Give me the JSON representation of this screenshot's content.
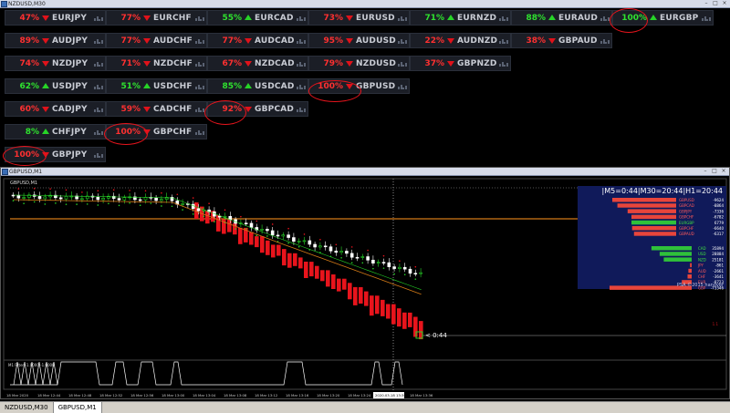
{
  "top_window": {
    "title": "NZDUSD,M30"
  },
  "grid": {
    "rows": [
      [
        {
          "pct": "47%",
          "dir": "down",
          "color": "red",
          "sym": "EURJPY"
        },
        {
          "pct": "77%",
          "dir": "down",
          "color": "red",
          "sym": "EURCHF"
        },
        {
          "pct": "55%",
          "dir": "up",
          "color": "green",
          "sym": "EURCAD"
        },
        {
          "pct": "73%",
          "dir": "down",
          "color": "red",
          "sym": "EURUSD"
        },
        {
          "pct": "71%",
          "dir": "up",
          "color": "green",
          "sym": "EURNZD"
        },
        {
          "pct": "88%",
          "dir": "up",
          "color": "green",
          "sym": "EURAUD"
        },
        {
          "pct": "100%",
          "dir": "up",
          "color": "green",
          "sym": "EURGBP"
        }
      ],
      [
        {
          "pct": "89%",
          "dir": "down",
          "color": "red",
          "sym": "AUDJPY"
        },
        {
          "pct": "77%",
          "dir": "down",
          "color": "red",
          "sym": "AUDCHF"
        },
        {
          "pct": "77%",
          "dir": "down",
          "color": "red",
          "sym": "AUDCAD"
        },
        {
          "pct": "95%",
          "dir": "down",
          "color": "red",
          "sym": "AUDUSD"
        },
        {
          "pct": "22%",
          "dir": "down",
          "color": "red",
          "sym": "AUDNZD"
        },
        {
          "pct": "38%",
          "dir": "down",
          "color": "red",
          "sym": "GBPAUD"
        }
      ],
      [
        {
          "pct": "74%",
          "dir": "down",
          "color": "red",
          "sym": "NZDJPY"
        },
        {
          "pct": "71%",
          "dir": "down",
          "color": "red",
          "sym": "NZDCHF"
        },
        {
          "pct": "67%",
          "dir": "down",
          "color": "red",
          "sym": "NZDCAD"
        },
        {
          "pct": "79%",
          "dir": "down",
          "color": "red",
          "sym": "NZDUSD"
        },
        {
          "pct": "37%",
          "dir": "down",
          "color": "red",
          "sym": "GBPNZD"
        }
      ],
      [
        {
          "pct": "62%",
          "dir": "up",
          "color": "green",
          "sym": "USDJPY"
        },
        {
          "pct": "51%",
          "dir": "up",
          "color": "green",
          "sym": "USDCHF"
        },
        {
          "pct": "85%",
          "dir": "up",
          "color": "green",
          "sym": "USDCAD"
        },
        {
          "pct": "100%",
          "dir": "down",
          "color": "red",
          "sym": "GBPUSD"
        }
      ],
      [
        {
          "pct": "60%",
          "dir": "down",
          "color": "red",
          "sym": "CADJPY"
        },
        {
          "pct": "59%",
          "dir": "down",
          "color": "red",
          "sym": "CADCHF"
        },
        {
          "pct": "92%",
          "dir": "down",
          "color": "red",
          "sym": "GBPCAD"
        }
      ],
      [
        {
          "pct": "8%",
          "dir": "up",
          "color": "green",
          "sym": "CHFJPY"
        },
        {
          "pct": "100%",
          "dir": "down",
          "color": "red",
          "sym": "GBPCHF"
        }
      ],
      [
        {
          "pct": "100%",
          "dir": "down",
          "color": "red",
          "sym": "GBPJPY"
        }
      ]
    ]
  },
  "chart_window": {
    "title": "GBPUSD,M1",
    "inner_label": "GBPUSD,M1"
  },
  "chart": {
    "price_label": "< 0:44",
    "indicator_label": "M1 Filter -1.0000 -1.0000",
    "date_tooltip": "2020.03.18 13:36",
    "time_ticks": [
      "18 Mar 2020",
      "18 Mar 12:44",
      "18 Mar 12:48",
      "18 Mar 12:52",
      "18 Mar 12:56",
      "18 Mar 13:00",
      "18 Mar 13:04",
      "18 Mar 13:08",
      "18 Mar 13:12",
      "18 Mar 13:16",
      "18 Mar 13:20",
      "18 Mar 13:24",
      "18 Mar 13:28",
      "18 Mar 13:36"
    ]
  },
  "psa_panel": {
    "header": "|M5=0:44|M30=20:44|H1=20:44",
    "pairs": [
      {
        "name": "GBPUSD",
        "value": "-9624",
        "color": "red",
        "strength": 1.0
      },
      {
        "name": "GBPCAD",
        "value": "-8864",
        "color": "red",
        "strength": 0.92
      },
      {
        "name": "GBPJPY",
        "value": "-7336",
        "color": "red",
        "strength": 0.76
      },
      {
        "name": "GBPCHF",
        "value": "-6782",
        "color": "red",
        "strength": 0.7
      },
      {
        "name": "EURGBP",
        "value": "6779",
        "color": "green",
        "strength": 0.7
      },
      {
        "name": "GBPCHF",
        "value": "-6640",
        "color": "red",
        "strength": 0.69
      },
      {
        "name": "GBPAUD",
        "value": "-6317",
        "color": "red",
        "strength": 0.66
      }
    ],
    "currencies": [
      {
        "name": "CAD",
        "value": "35894",
        "color": "green",
        "strength": 0.49
      },
      {
        "name": "USD",
        "value": "28884",
        "color": "green",
        "strength": 0.39
      },
      {
        "name": "NZD",
        "value": "25181",
        "color": "green",
        "strength": 0.34
      },
      {
        "name": "JPY",
        "value": "-861",
        "color": "red",
        "strength": 0.02
      },
      {
        "name": "AUD",
        "value": "-2661",
        "color": "red",
        "strength": 0.04
      },
      {
        "name": "CHF",
        "value": "-3641",
        "color": "red",
        "strength": 0.05
      },
      {
        "name": "EUR",
        "value": "-8723",
        "color": "red",
        "strength": 0.12
      },
      {
        "name": "GBP",
        "value": "-73346",
        "color": "red",
        "strength": 1.0
      }
    ],
    "footer": "PSA ©2015 hanover"
  },
  "tabs": [
    {
      "label": "NZDUSD,M30",
      "active": false
    },
    {
      "label": "GBPUSD,M1",
      "active": true
    }
  ],
  "colors": {
    "bull": "#27d427",
    "bear": "#e0121a",
    "bg": "#000000",
    "panel": "#101a5a"
  }
}
